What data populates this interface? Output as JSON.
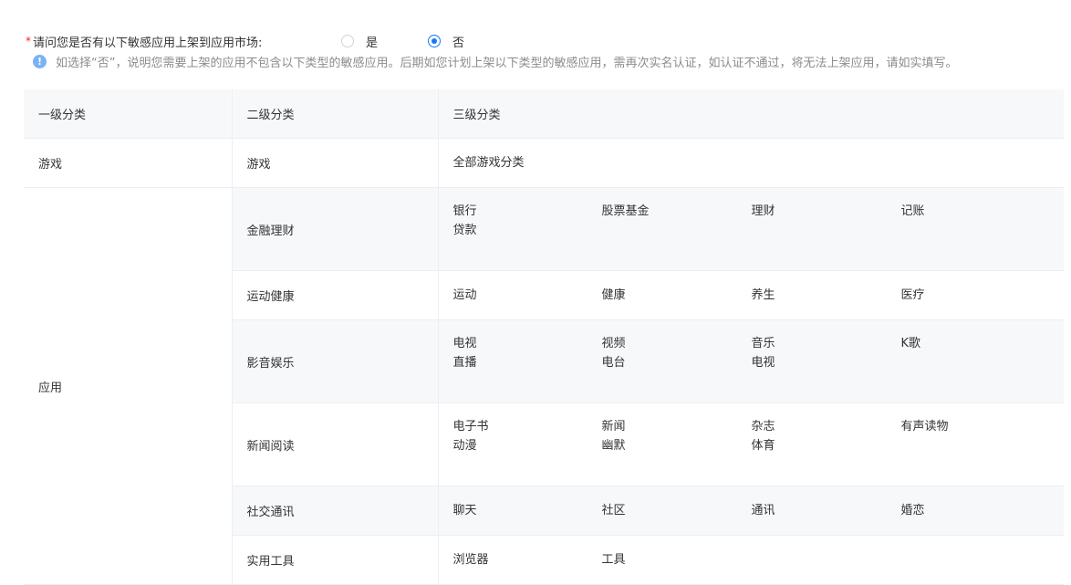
{
  "question": {
    "required_mark": "*",
    "text": "请问您是否有以下敏感应用上架到应用市场:",
    "options": [
      {
        "label": "是",
        "checked": false
      },
      {
        "label": "否",
        "checked": true
      }
    ]
  },
  "hint": {
    "icon": "info-icon",
    "icon_glyph": "!",
    "text": "如选择“否”，说明您需要上架的应用不包含以下类型的敏感应用。后期如您计划上架以下类型的敏感应用，需再次实名认证，如认证不通过，将无法上架应用，请如实填写。"
  },
  "table": {
    "headers": [
      "一级分类",
      "二级分类",
      "三级分类"
    ],
    "groups": [
      {
        "level1": "游戏",
        "rows": [
          {
            "level2": "游戏",
            "level3": [
              "全部游戏分类"
            ]
          }
        ]
      },
      {
        "level1": "应用",
        "rows": [
          {
            "level2": "金融理财",
            "level3": [
              "银行",
              "股票基金",
              "理财",
              "记账",
              "贷款"
            ]
          },
          {
            "level2": "运动健康",
            "level3": [
              "运动",
              "健康",
              "养生",
              "医疗"
            ]
          },
          {
            "level2": "影音娱乐",
            "level3": [
              "电视",
              "视频",
              "音乐",
              "K歌",
              "直播",
              "电台",
              "电视"
            ]
          },
          {
            "level2": "新闻阅读",
            "level3": [
              "电子书",
              "新闻",
              "杂志",
              "有声读物",
              "动漫",
              "幽默",
              "体育"
            ]
          },
          {
            "level2": "社交通讯",
            "level3": [
              "聊天",
              "社区",
              "通讯",
              "婚恋"
            ]
          },
          {
            "level2": "实用工具",
            "level3": [
              "浏览器",
              "工具"
            ]
          }
        ]
      }
    ]
  },
  "colors": {
    "accent": "#1677ff",
    "required": "#f5222d",
    "header_bg": "#f7f8fa",
    "border": "#ebeef5",
    "hint_text": "#8c8c8c",
    "info_icon": "#7ab3f5"
  }
}
